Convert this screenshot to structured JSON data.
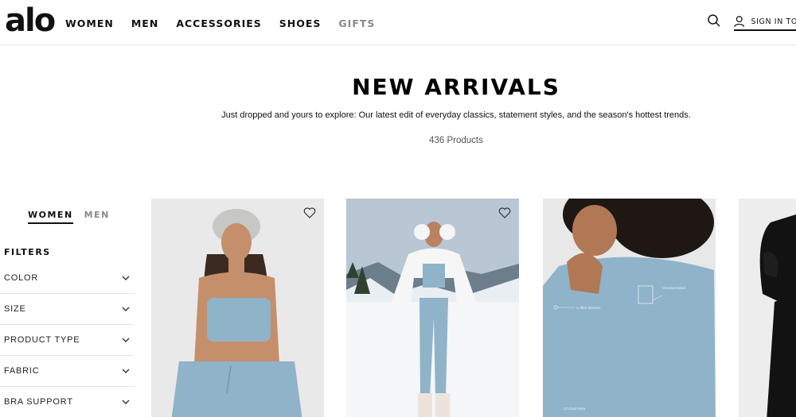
{
  "header": {
    "logo": "alo",
    "nav": [
      "WOMEN",
      "MEN",
      "ACCESSORIES",
      "SHOES",
      "GIFTS"
    ],
    "signin_label": "SIGN IN TO"
  },
  "hero": {
    "title": "NEW ARRIVALS",
    "description": "Just dropped and yours to explore: Our latest edit of everyday classics, statement styles, and the season's hottest trends.",
    "count": "436 Products"
  },
  "sidebar": {
    "gender_tabs": [
      "WOMEN",
      "MEN"
    ],
    "active_tab": "WOMEN",
    "filters_heading": "FILTERS",
    "filters": [
      "COLOR",
      "SIZE",
      "PRODUCT TYPE",
      "FABRIC",
      "BRA SUPPORT"
    ]
  },
  "products": [
    {
      "image": "model-in-blue-knit-bra-and-beanie",
      "wishlist": "heart-icon"
    },
    {
      "image": "model-in-snow-with-white-puffer-and-earmuffs",
      "wishlist": "heart-icon"
    },
    {
      "image": "model-in-blue-sweatshirt-detail",
      "wishlist": "",
      "tags": [
        "Chrome Detail",
        "Cuffed Sleeves",
        "Cinched Hem"
      ]
    },
    {
      "image": "model-in-black-outfit",
      "wishlist": ""
    }
  ],
  "colors": {
    "text": "#111111",
    "muted": "#8a8a8a",
    "border": "#e2e2e2",
    "product_blue": "#8fb3c9"
  }
}
